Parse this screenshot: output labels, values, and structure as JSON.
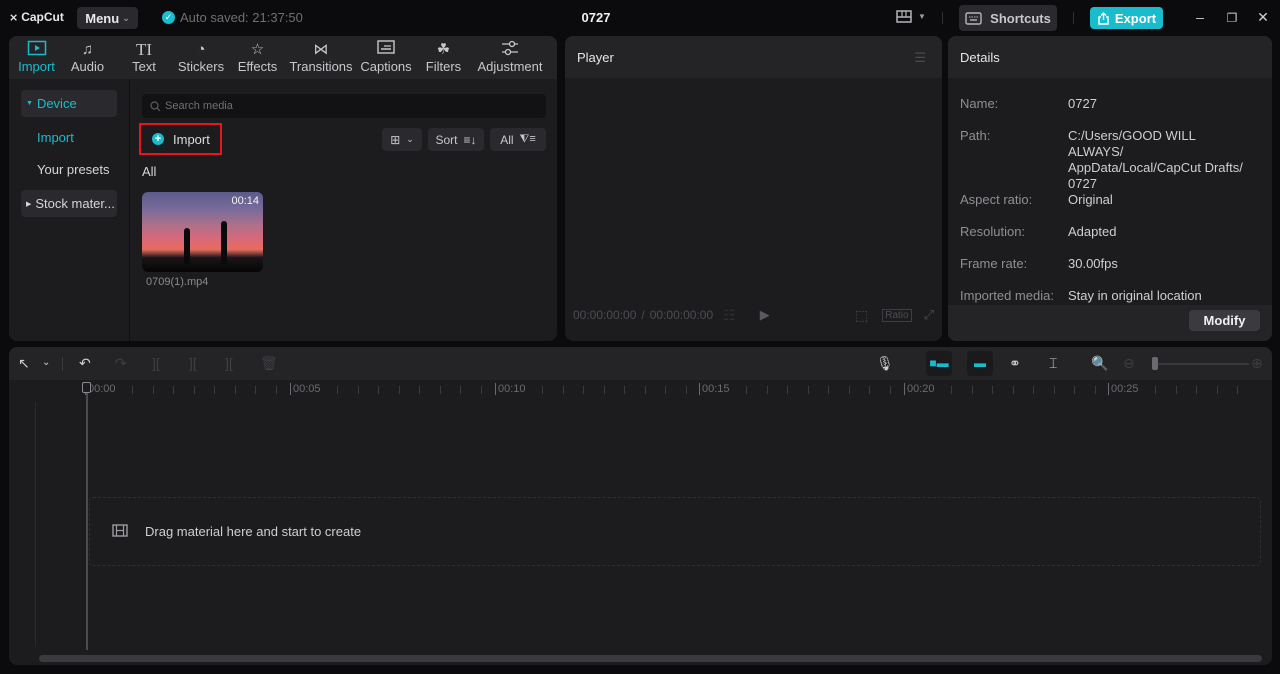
{
  "titlebar": {
    "app_name": "CapCut",
    "menu_label": "Menu",
    "autosave_text": "Auto saved: 21:37:50",
    "project_title": "0727",
    "shortcuts_label": "Shortcuts",
    "export_label": "Export",
    "accent_color": "#19bccd"
  },
  "media_tabs": [
    {
      "label": "Import",
      "icon": "import-icon",
      "active": true
    },
    {
      "label": "Audio",
      "icon": "audio-icon"
    },
    {
      "label": "Text",
      "icon": "text-icon"
    },
    {
      "label": "Stickers",
      "icon": "stickers-icon"
    },
    {
      "label": "Effects",
      "icon": "effects-icon"
    },
    {
      "label": "Transitions",
      "icon": "transitions-icon"
    },
    {
      "label": "Captions",
      "icon": "captions-icon"
    },
    {
      "label": "Filters",
      "icon": "filters-icon"
    },
    {
      "label": "Adjustment",
      "icon": "adjustment-icon"
    }
  ],
  "sidebar": {
    "device_label": "Device",
    "import_label": "Import",
    "presets_label": "Your presets",
    "stock_label": "Stock mater..."
  },
  "media": {
    "search_placeholder": "Search media",
    "import_button": "Import",
    "sort_label": "Sort",
    "filter_label": "All",
    "section_label": "All",
    "items": [
      {
        "filename": "0709(1).mp4",
        "duration": "00:14"
      }
    ]
  },
  "player": {
    "title": "Player",
    "current_time": "00:00:00:00",
    "separator": "/",
    "total_time": "00:00:00:00",
    "ratio_label": "Ratio"
  },
  "details": {
    "title": "Details",
    "rows": [
      {
        "key": "Name:",
        "value": "0727"
      },
      {
        "key": "Path:",
        "value": "C:/Users/GOOD WILL ALWAYS/ AppData/Local/CapCut Drafts/ 0727"
      },
      {
        "key": "Aspect ratio:",
        "value": "Original"
      },
      {
        "key": "Resolution:",
        "value": "Adapted"
      },
      {
        "key": "Frame rate:",
        "value": "30.00fps"
      },
      {
        "key": "Imported media:",
        "value": "Stay in original location"
      }
    ],
    "modify_label": "Modify"
  },
  "timeline": {
    "ruler_labels": [
      "00:00",
      "00:05",
      "00:10",
      "00:15",
      "00:20",
      "00:25"
    ],
    "dropzone_text": "Drag material here and start to create",
    "zoom_level": 0.05
  }
}
